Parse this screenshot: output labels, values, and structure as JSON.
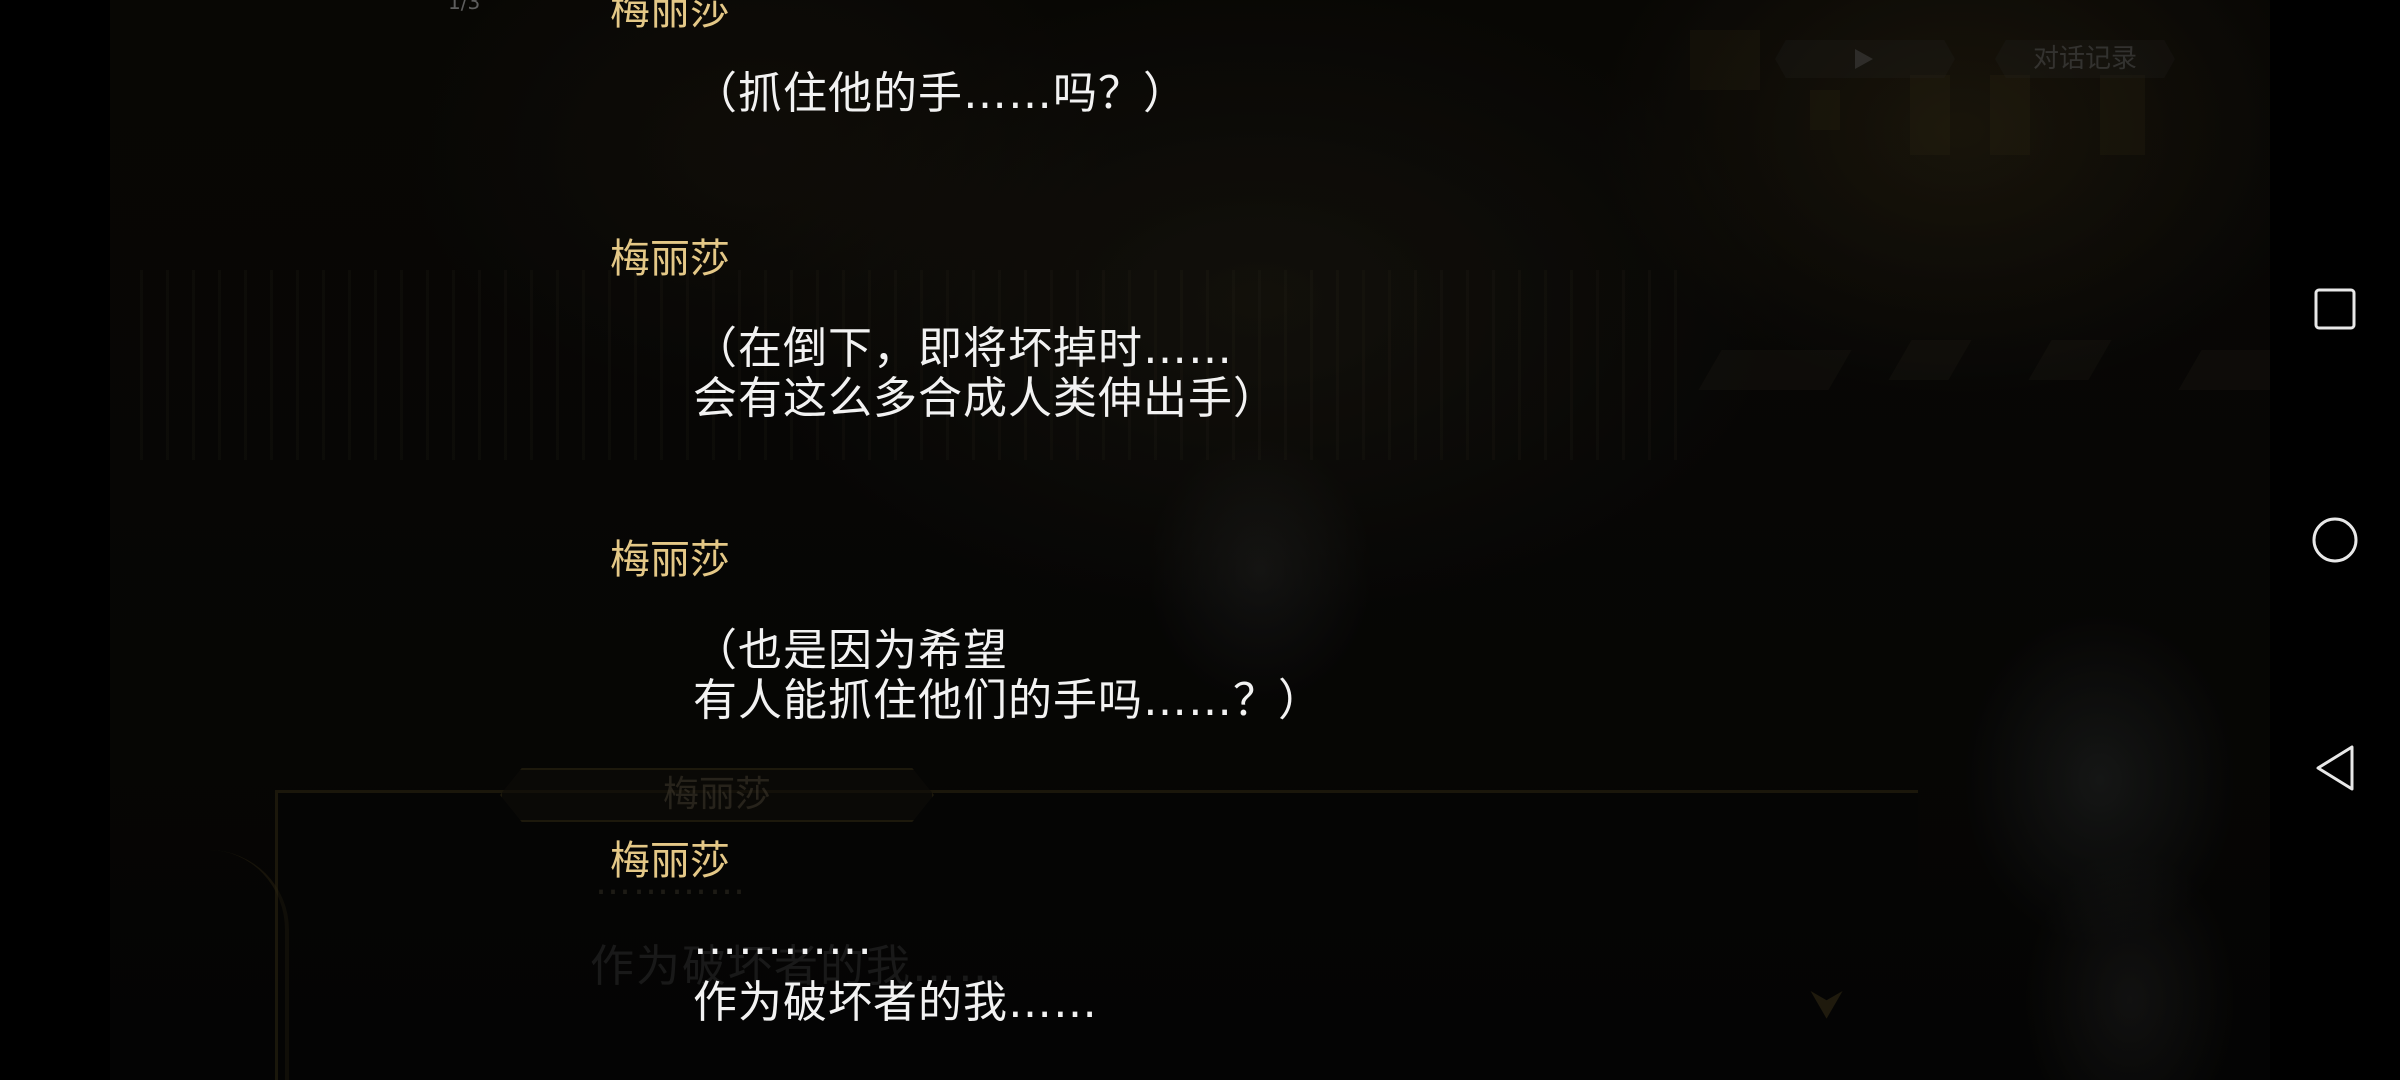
{
  "top_counter": "1/3",
  "ghost_ui": {
    "log_button_label": "对话记录",
    "name_plate": "梅丽莎",
    "dots": "…………",
    "dialog_text": "作为破坏者的我……"
  },
  "dialogue_log": [
    {
      "speaker": "梅丽莎",
      "lines": [
        "（抓住他的手……吗？）"
      ]
    },
    {
      "speaker": "梅丽莎",
      "lines": [
        "（在倒下，即将坏掉时……",
        "会有这么多合成人类伸出手）"
      ]
    },
    {
      "speaker": "梅丽莎",
      "lines": [
        "（也是因为希望",
        "有人能抓住他们的手吗……？）"
      ]
    },
    {
      "speaker": "梅丽莎",
      "lines": [
        "…………",
        "作为破坏者的我……"
      ]
    }
  ],
  "nav_bar": {
    "icons": [
      "recents-square-icon",
      "home-circle-icon",
      "back-triangle-icon"
    ]
  }
}
